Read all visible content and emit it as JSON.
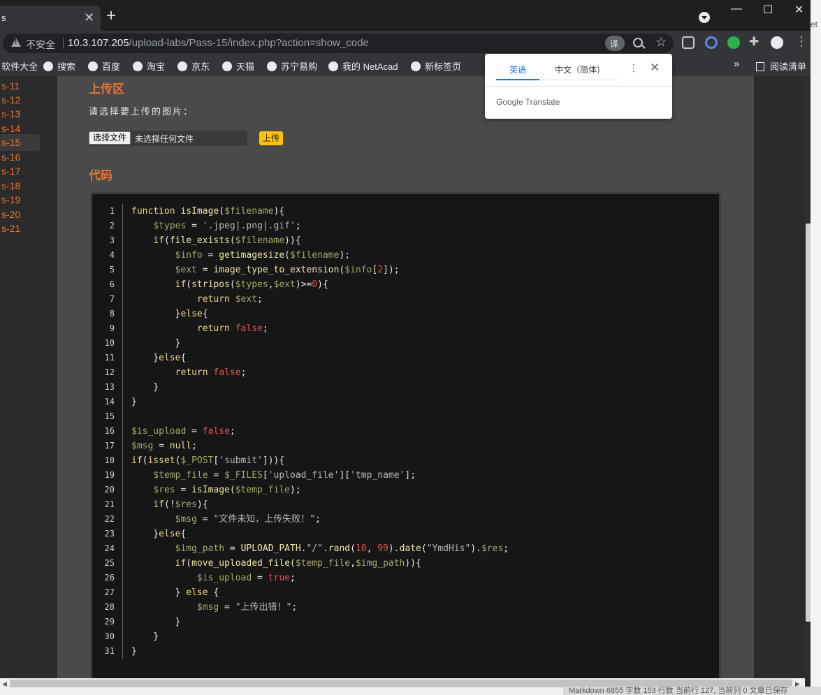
{
  "browser": {
    "tab_title": "s",
    "tab_close": "✕",
    "new_tab": "+",
    "window_controls": {
      "minimize": "—",
      "maximize": "☐",
      "close": "✕"
    },
    "security_label": "不安全",
    "url_host": "10.3.107.205",
    "url_path": "/upload-labs/Pass-15/index.php?action=show_code",
    "icons": [
      "translate-icon",
      "zoom-icon",
      "star-icon",
      "reading-mode-icon",
      "extension-circle-icon",
      "extension-green-icon",
      "puzzle-icon",
      "profile-icon",
      "menu-icon"
    ],
    "bookmarks": [
      "软件大全",
      "搜索",
      "百度",
      "淘宝",
      "京东",
      "天猫",
      "苏宁易购",
      "我的 NetAcad",
      "新标签页"
    ],
    "bookmarks_more": "»",
    "reading_list": "阅读清单"
  },
  "translate_popup": {
    "tab_source": "英语",
    "tab_target": "中文（简体）",
    "brand": "Google Translate"
  },
  "sidebar": {
    "items": [
      "s-11",
      "s-12",
      "s-13",
      "s-14",
      "s-15",
      "s-16",
      "s-17",
      "s-18",
      "s-19",
      "s-20",
      "s-21"
    ],
    "active": "s-15"
  },
  "upload": {
    "title": "上传区",
    "prompt": "请选择要上传的图片：",
    "file_button": "选择文件",
    "no_file": "未选择任何文件",
    "submit": "上传"
  },
  "code_section": {
    "title": "代码",
    "lines": [
      "function isImage($filename){",
      "    $types = '.jpeg|.png|.gif';",
      "    if(file_exists($filename)){",
      "        $info = getimagesize($filename);",
      "        $ext = image_type_to_extension($info[2]);",
      "        if(stripos($types,$ext)>=0){",
      "            return $ext;",
      "        }else{",
      "            return false;",
      "        }",
      "    }else{",
      "        return false;",
      "    }",
      "}",
      "",
      "$is_upload = false;",
      "$msg = null;",
      "if(isset($_POST['submit'])){",
      "    $temp_file = $_FILES['upload_file']['tmp_name'];",
      "    $res = isImage($temp_file);",
      "    if(!$res){",
      "        $msg = \"文件未知，上传失败！\";",
      "    }else{",
      "        $img_path = UPLOAD_PATH.\"/\".rand(10, 99).date(\"YmdHis\").$res;",
      "        if(move_uploaded_file($temp_file,$img_path)){",
      "            $is_upload = true;",
      "        } else {",
      "            $msg = \"上传出错！\";",
      "        }",
      "    }",
      "}"
    ]
  },
  "status_fragment": "Markdown  6855 字数  153 行数  当前行 127, 当前列 0  文章已保存",
  "colors": {
    "accent": "#e87431",
    "upload_button": "#ffc107",
    "code_bg": "#161616",
    "content_bg": "#4a4a4a"
  }
}
